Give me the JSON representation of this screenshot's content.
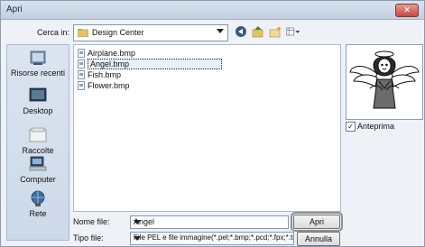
{
  "window": {
    "title": "Apri",
    "close_glyph": "×"
  },
  "toolbar": {
    "lookin_label": "Cerca in:",
    "lookin_value": "Design Center",
    "icons": [
      "back-icon",
      "up-folder-icon",
      "new-folder-icon",
      "views-menu-icon"
    ]
  },
  "places": [
    {
      "label": "Risorse recenti",
      "icon": "recent-icon"
    },
    {
      "label": "Desktop",
      "icon": "desktop-icon"
    },
    {
      "label": "Raccolte",
      "icon": "libraries-icon"
    },
    {
      "label": "Computer",
      "icon": "computer-icon"
    },
    {
      "label": "Rete",
      "icon": "network-icon"
    }
  ],
  "files": [
    {
      "name": "Airplane.bmp",
      "selected": false
    },
    {
      "name": "Angel.bmp",
      "selected": true
    },
    {
      "name": "Fish.bmp",
      "selected": false
    },
    {
      "name": "Flower.bmp",
      "selected": false
    }
  ],
  "preview": {
    "checkbox_label": "Anteprima",
    "checked": true,
    "check_glyph": "✓",
    "image": "angel-embroidery-preview"
  },
  "form": {
    "filename_label": "Nome file:",
    "filename_value": "Angel",
    "filetype_label": "Tipo file:",
    "filetype_value": "File PEL e file immagine(*.pel;*.bmp;*.pcd;*.fpx;*.tif;*.g"
  },
  "buttons": {
    "open": "Apri",
    "cancel": "Annulla"
  },
  "colors": {
    "accent": "#7e9ab8",
    "close": "#c44b3e"
  }
}
